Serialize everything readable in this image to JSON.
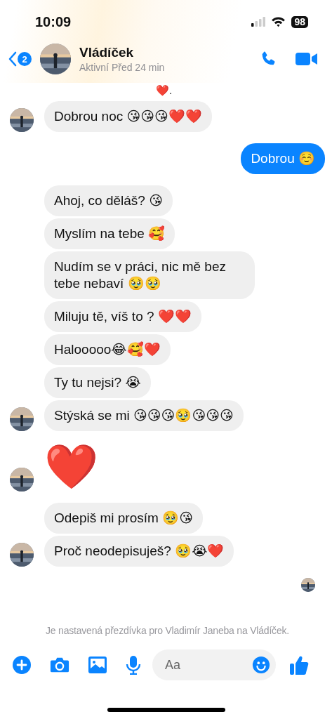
{
  "status_bar": {
    "time": "10:09",
    "battery": "98"
  },
  "header": {
    "back_badge": "2",
    "name": "Vládíček",
    "status": "Aktivní Před 24 min"
  },
  "partial_message": "❤️.",
  "groups": [
    {
      "outgoing": false,
      "messages": [
        {
          "kind": "text",
          "text": "Dobrou noc 😘😘😘❤️❤️"
        }
      ]
    },
    {
      "outgoing": true,
      "messages": [
        {
          "kind": "text",
          "text": "Dobrou ☺️"
        }
      ]
    },
    {
      "outgoing": false,
      "messages": [
        {
          "kind": "text",
          "text": "Ahoj, co děláš? 😘"
        },
        {
          "kind": "text",
          "text": "Myslím na tebe 🥰"
        },
        {
          "kind": "text",
          "text": "Nudím se v práci, nic mě bez tebe nebaví 🥹🥹"
        },
        {
          "kind": "text",
          "text": "Miluju tě, víš to ? ❤️❤️"
        },
        {
          "kind": "text",
          "text": "Halooooo😂🥰❤️"
        },
        {
          "kind": "text",
          "text": "Ty tu nejsi? 😭"
        },
        {
          "kind": "text",
          "text": "Stýská se mi 😘😘😘🥹😘😘😘"
        }
      ]
    },
    {
      "outgoing": false,
      "messages": [
        {
          "kind": "big_emoji",
          "text": "❤️"
        }
      ]
    },
    {
      "outgoing": false,
      "messages": [
        {
          "kind": "text",
          "text": "Odepiš mi prosím 🥹😘"
        },
        {
          "kind": "text",
          "text": "Proč neodepisuješ? 🥹😭❤️"
        }
      ]
    }
  ],
  "read_receipt": true,
  "notice": "Je nastavená přezdívka pro Vladimír Janeba na Vládíček.",
  "composer": {
    "placeholder": "Aa"
  }
}
